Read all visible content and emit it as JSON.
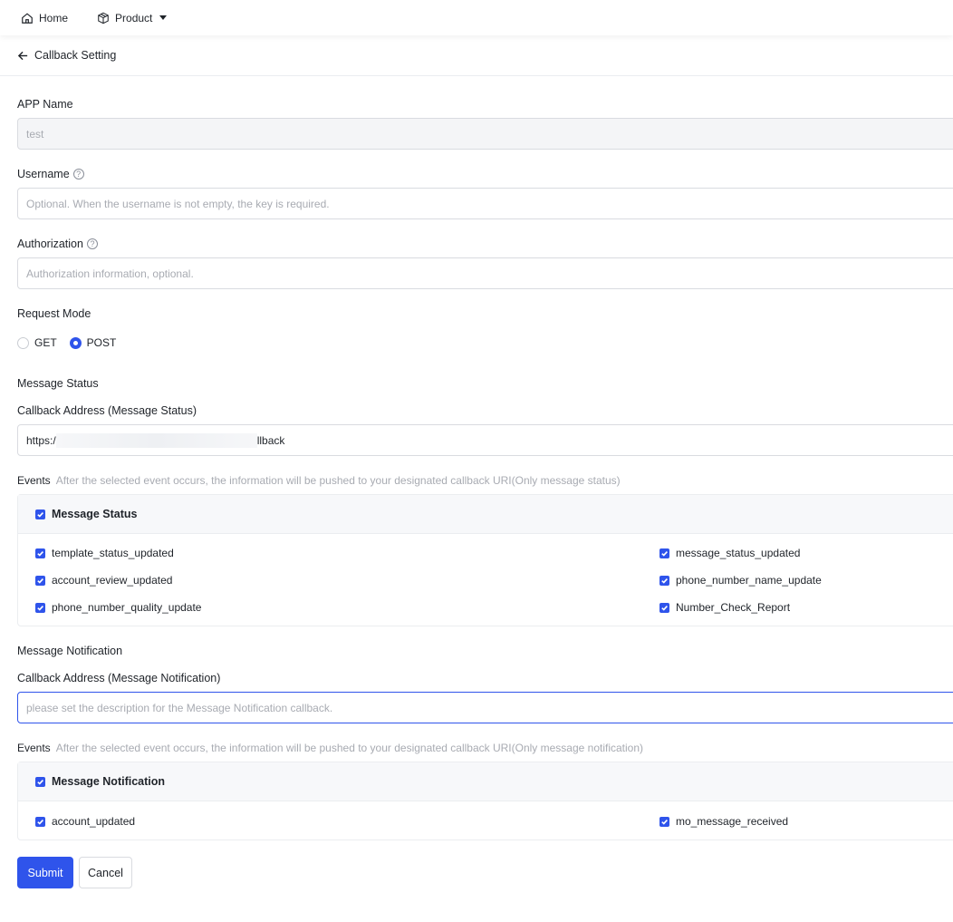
{
  "nav": {
    "home_label": "Home",
    "product_label": "Product"
  },
  "header": {
    "title": "Callback Setting"
  },
  "form": {
    "app_name": {
      "label": "APP Name",
      "value": "test"
    },
    "username": {
      "label": "Username",
      "placeholder": "Optional. When the username is not empty, the key is required."
    },
    "authorization": {
      "label": "Authorization",
      "placeholder": "Authorization information, optional."
    },
    "request_mode": {
      "label": "Request Mode",
      "options": [
        "GET",
        "POST"
      ],
      "selected": "POST"
    }
  },
  "message_status": {
    "section_title": "Message Status",
    "callback_label": "Callback Address (Message Status)",
    "callback_value_prefix": "https:/",
    "callback_value_suffix": "llback",
    "events_label": "Events",
    "events_hint": "After the selected event occurs, the information will be pushed to your designated callback URI(Only message status)",
    "group_label": "Message Status",
    "events": [
      "template_status_updated",
      "message_status_updated",
      "account_review_updated",
      "phone_number_name_update",
      "phone_number_quality_update",
      "Number_Check_Report"
    ]
  },
  "message_notification": {
    "section_title": "Message Notification",
    "callback_label": "Callback Address (Message Notification)",
    "callback_placeholder": "please set the description for the Message Notification callback.",
    "events_label": "Events",
    "events_hint": "After the selected event occurs, the information will be pushed to your designated callback URI(Only message notification)",
    "group_label": "Message Notification",
    "events": [
      "account_updated",
      "mo_message_received"
    ]
  },
  "actions": {
    "submit_label": "Submit",
    "cancel_label": "Cancel"
  },
  "colors": {
    "primary": "#2f54eb",
    "border": "#d9dbe0",
    "placeholder": "#a8abb2"
  }
}
